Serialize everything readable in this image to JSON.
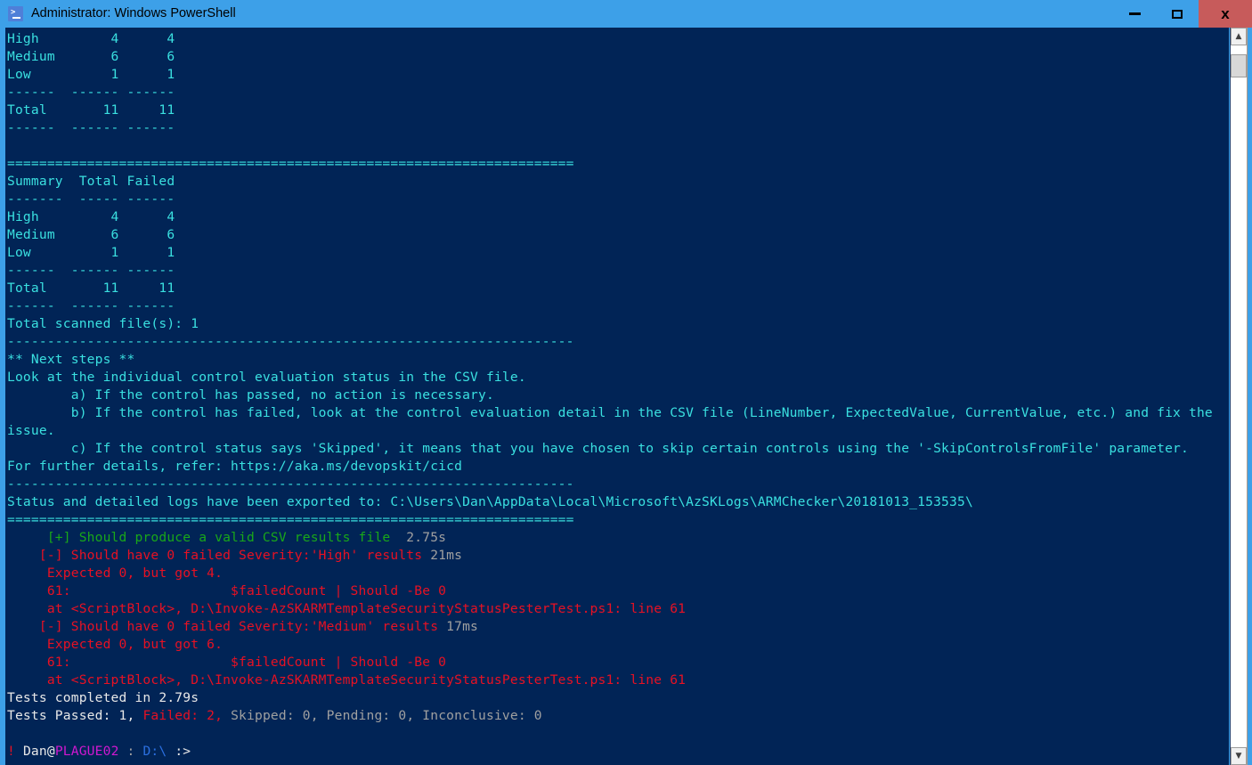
{
  "window": {
    "title": "Administrator: Windows PowerShell",
    "icon": "powershell-icon",
    "minimize_label": "",
    "maximize_label": "",
    "close_label": "x",
    "colors": {
      "frame": "#3da0e8",
      "console_bg": "#012456",
      "close_button": "#c75b5b",
      "cyan": "#3ae0e0",
      "green": "#19a819",
      "red": "#e81123",
      "gray": "#a0a0a0",
      "magenta": "#d018d0",
      "blue": "#2b6fe0",
      "white": "#e8e8e8"
    }
  },
  "scrollbar": {
    "up_arrow": "▲",
    "down_arrow": "▼"
  },
  "console": {
    "lines": [
      {
        "segments": [
          {
            "text": "High         4      4",
            "color": "cyan"
          }
        ]
      },
      {
        "segments": [
          {
            "text": "Medium       6      6",
            "color": "cyan"
          }
        ]
      },
      {
        "segments": [
          {
            "text": "Low          1      1",
            "color": "cyan"
          }
        ]
      },
      {
        "segments": [
          {
            "text": "------  ------ ------",
            "color": "cyan"
          }
        ]
      },
      {
        "segments": [
          {
            "text": "Total       11     11",
            "color": "cyan"
          }
        ]
      },
      {
        "segments": [
          {
            "text": "------  ------ ------",
            "color": "cyan"
          }
        ]
      },
      {
        "segments": [
          {
            "text": "",
            "color": "cyan"
          }
        ]
      },
      {
        "segments": [
          {
            "text": "=======================================================================",
            "color": "cyan"
          }
        ]
      },
      {
        "segments": [
          {
            "text": "Summary  Total Failed",
            "color": "cyan"
          }
        ]
      },
      {
        "segments": [
          {
            "text": "-------  ----- ------",
            "color": "cyan"
          }
        ]
      },
      {
        "segments": [
          {
            "text": "High         4      4",
            "color": "cyan"
          }
        ]
      },
      {
        "segments": [
          {
            "text": "Medium       6      6",
            "color": "cyan"
          }
        ]
      },
      {
        "segments": [
          {
            "text": "Low          1      1",
            "color": "cyan"
          }
        ]
      },
      {
        "segments": [
          {
            "text": "------  ------ ------",
            "color": "cyan"
          }
        ]
      },
      {
        "segments": [
          {
            "text": "Total       11     11",
            "color": "cyan"
          }
        ]
      },
      {
        "segments": [
          {
            "text": "------  ------ ------",
            "color": "cyan"
          }
        ]
      },
      {
        "segments": [
          {
            "text": "Total scanned file(s): 1",
            "color": "cyan"
          }
        ]
      },
      {
        "segments": [
          {
            "text": "-----------------------------------------------------------------------",
            "color": "cyan"
          }
        ]
      },
      {
        "segments": [
          {
            "text": "** Next steps **",
            "color": "cyan"
          }
        ]
      },
      {
        "segments": [
          {
            "text": "Look at the individual control evaluation status in the CSV file.",
            "color": "cyan"
          }
        ]
      },
      {
        "segments": [
          {
            "text": "        a) If the control has passed, no action is necessary.",
            "color": "cyan"
          }
        ]
      },
      {
        "segments": [
          {
            "text": "        b) If the control has failed, look at the control evaluation detail in the CSV file (LineNumber, ExpectedValue, CurrentValue, etc.) and fix the",
            "color": "cyan"
          }
        ]
      },
      {
        "segments": [
          {
            "text": "issue.",
            "color": "cyan"
          }
        ]
      },
      {
        "segments": [
          {
            "text": "        c) If the control status says 'Skipped', it means that you have chosen to skip certain controls using the '-SkipControlsFromFile' parameter.",
            "color": "cyan"
          }
        ]
      },
      {
        "segments": [
          {
            "text": "For further details, refer: https://aka.ms/devopskit/cicd",
            "color": "cyan"
          }
        ]
      },
      {
        "segments": [
          {
            "text": "-----------------------------------------------------------------------",
            "color": "cyan"
          }
        ]
      },
      {
        "segments": [
          {
            "text": "Status and detailed logs have been exported to: C:\\Users\\Dan\\AppData\\Local\\Microsoft\\AzSKLogs\\ARMChecker\\20181013_153535\\",
            "color": "cyan"
          }
        ]
      },
      {
        "segments": [
          {
            "text": "=======================================================================",
            "color": "cyan"
          }
        ]
      },
      {
        "segments": [
          {
            "text": "     [+] Should produce a valid CSV results file ",
            "color": "green"
          },
          {
            "text": " 2.75s",
            "color": "gray"
          }
        ]
      },
      {
        "segments": [
          {
            "text": "    [-] Should have 0 failed Severity:'High' results ",
            "color": "red"
          },
          {
            "text": "21ms",
            "color": "gray"
          }
        ]
      },
      {
        "segments": [
          {
            "text": "     Expected 0, but got 4.",
            "color": "red"
          }
        ]
      },
      {
        "segments": [
          {
            "text": "     61:                    $failedCount | Should -Be 0",
            "color": "red"
          }
        ]
      },
      {
        "segments": [
          {
            "text": "     at <ScriptBlock>, D:\\Invoke-AzSKARMTemplateSecurityStatusPesterTest.ps1: line 61",
            "color": "red"
          }
        ]
      },
      {
        "segments": [
          {
            "text": "    [-] Should have 0 failed Severity:'Medium' results ",
            "color": "red"
          },
          {
            "text": "17ms",
            "color": "gray"
          }
        ]
      },
      {
        "segments": [
          {
            "text": "     Expected 0, but got 6.",
            "color": "red"
          }
        ]
      },
      {
        "segments": [
          {
            "text": "     61:                    $failedCount | Should -Be 0",
            "color": "red"
          }
        ]
      },
      {
        "segments": [
          {
            "text": "     at <ScriptBlock>, D:\\Invoke-AzSKARMTemplateSecurityStatusPesterTest.ps1: line 61",
            "color": "red"
          }
        ]
      },
      {
        "segments": [
          {
            "text": "Tests completed in 2.79s",
            "color": "white"
          }
        ]
      },
      {
        "segments": [
          {
            "text": "Tests Passed: 1, ",
            "color": "white"
          },
          {
            "text": "Failed: 2,",
            "color": "red"
          },
          {
            "text": " Skipped: 0, Pending: 0, Inconclusive: 0",
            "color": "gray"
          }
        ]
      },
      {
        "segments": [
          {
            "text": "",
            "color": "cyan"
          }
        ]
      },
      {
        "segments": [
          {
            "text": "! ",
            "color": "red"
          },
          {
            "text": "Dan@",
            "color": "white"
          },
          {
            "text": "PLAGUE02",
            "color": "magenta"
          },
          {
            "text": " : ",
            "color": "gray"
          },
          {
            "text": "D:\\",
            "color": "blue"
          },
          {
            "text": " ",
            "color": "gray"
          },
          {
            "text": ":>",
            "color": "white"
          }
        ]
      }
    ]
  }
}
